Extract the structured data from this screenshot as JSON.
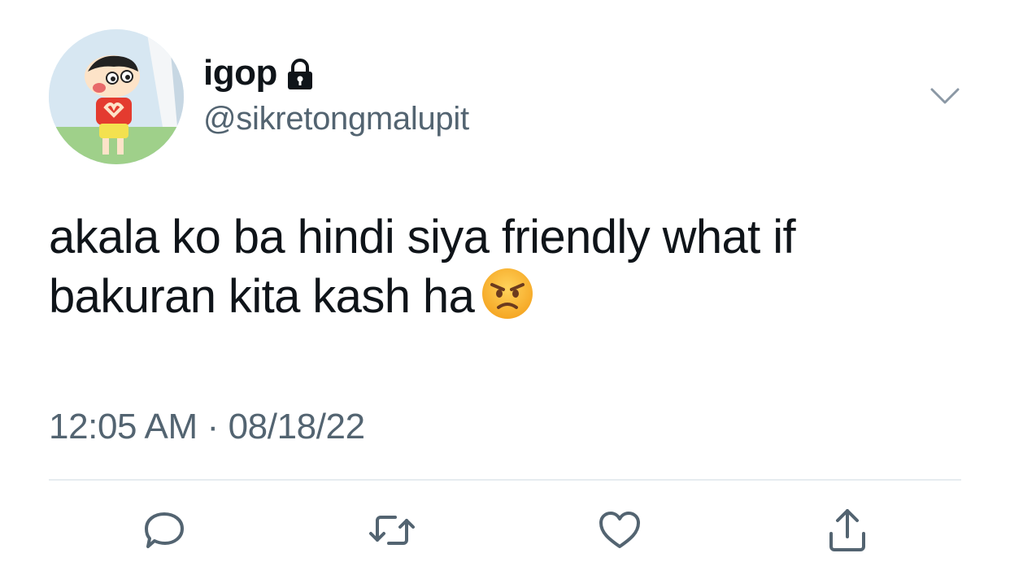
{
  "author": {
    "display_name": "igop",
    "handle": "@sikretongmalupit",
    "protected": true,
    "avatar_icon": "cartoon-avatar-icon"
  },
  "tweet": {
    "text_line_1": "akala ko ba hindi siya friendly what if",
    "text_line_2": "bakuran kita kash ha",
    "emoji": "angry-face-emoji",
    "timestamp": "12:05 AM · 08/18/22"
  },
  "actions": [
    {
      "icon": "reply-icon"
    },
    {
      "icon": "retweet-icon"
    },
    {
      "icon": "like-icon"
    },
    {
      "icon": "share-icon"
    }
  ],
  "colors": {
    "text_primary": "#0f1419",
    "text_secondary": "#536471",
    "icon_gray": "#536471",
    "divider": "#e6ecf0",
    "emoji_face": "#f9b233"
  }
}
